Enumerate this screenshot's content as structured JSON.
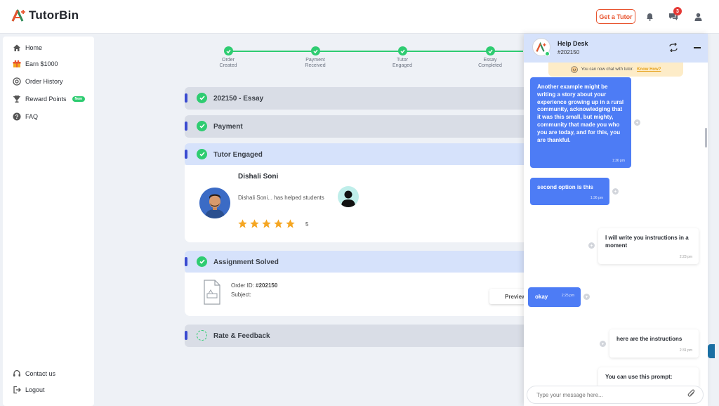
{
  "brand": {
    "name": "TutorBin"
  },
  "topbar": {
    "get_tutor": "Get a Tutor",
    "chat_badge": "3"
  },
  "sidebar": {
    "items": [
      {
        "label": "Home",
        "icon": "home-icon"
      },
      {
        "label": "Earn $1000",
        "icon": "gift-icon"
      },
      {
        "label": "Order History",
        "icon": "order-history-icon"
      },
      {
        "label": "Reward Points",
        "icon": "trophy-icon",
        "badge": "New"
      },
      {
        "label": "FAQ",
        "icon": "help-circle-icon"
      }
    ],
    "contact": "Contact us",
    "logout": "Logout"
  },
  "stepper": [
    {
      "line1": "Order",
      "line2": "Created"
    },
    {
      "line1": "Payment",
      "line2": "Received"
    },
    {
      "line1": "Tutor",
      "line2": "Engaged"
    },
    {
      "line1": "Essay",
      "line2": "Completed"
    }
  ],
  "sections": {
    "order": "202150 - Essay",
    "payment": "Payment",
    "tutor": "Tutor Engaged",
    "assignment": "Assignment Solved",
    "rate": "Rate & Feedback"
  },
  "tutor": {
    "name": "Dishali Soni",
    "helped_text": "Dishali Soni... has helped   students",
    "rating": 5,
    "rating_label": "5"
  },
  "assignment": {
    "order_label": "Order ID:",
    "order_id": "#202150",
    "subject_label": "Subject:",
    "preview": "Preview"
  },
  "chat": {
    "title": "Help Desk",
    "order": "#202150",
    "notice": "You can now chat with tutor.",
    "notice_link": "Know How?",
    "messages": [
      {
        "dir": "out",
        "text": "Another example might be writing a story about your experience growing up in a rural community, acknowledging that it was this small, but mighty, community that made you who you are today, and for this, you are thankful.",
        "time": "1:36 pm"
      },
      {
        "dir": "out",
        "text": "second option is this",
        "time": "1:36 pm"
      },
      {
        "dir": "in",
        "text": "I will write you instructions in a moment",
        "time": "2:23 pm"
      },
      {
        "dir": "out",
        "text": "okay",
        "time": "2:25 pm"
      },
      {
        "dir": "in",
        "text": "here are the instructions",
        "time": "2:31 pm"
      },
      {
        "dir": "in",
        "text": "You can use this prompt:",
        "time": ""
      }
    ],
    "input_placeholder": "Type your message here..."
  },
  "colors": {
    "accent": "#4d7cf5",
    "success": "#2ecc71",
    "brand_orange": "#e8542f"
  }
}
